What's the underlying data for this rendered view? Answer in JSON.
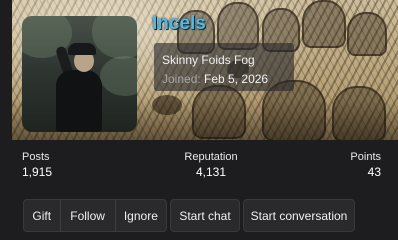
{
  "profile": {
    "username": "Incels",
    "user_title": "Skinny Foids Fog",
    "joined_label": "Joined:",
    "joined_date": "Feb 5, 2026",
    "username_color": "#56b8e0"
  },
  "stats": {
    "posts": {
      "label": "Posts",
      "value": "1,915"
    },
    "reputation": {
      "label": "Reputation",
      "value": "4,131"
    },
    "points": {
      "label": "Points",
      "value": "43"
    }
  },
  "actions": {
    "gift": "Gift",
    "follow": "Follow",
    "ignore": "Ignore",
    "start_chat": "Start chat",
    "start_conversation": "Start conversation"
  }
}
